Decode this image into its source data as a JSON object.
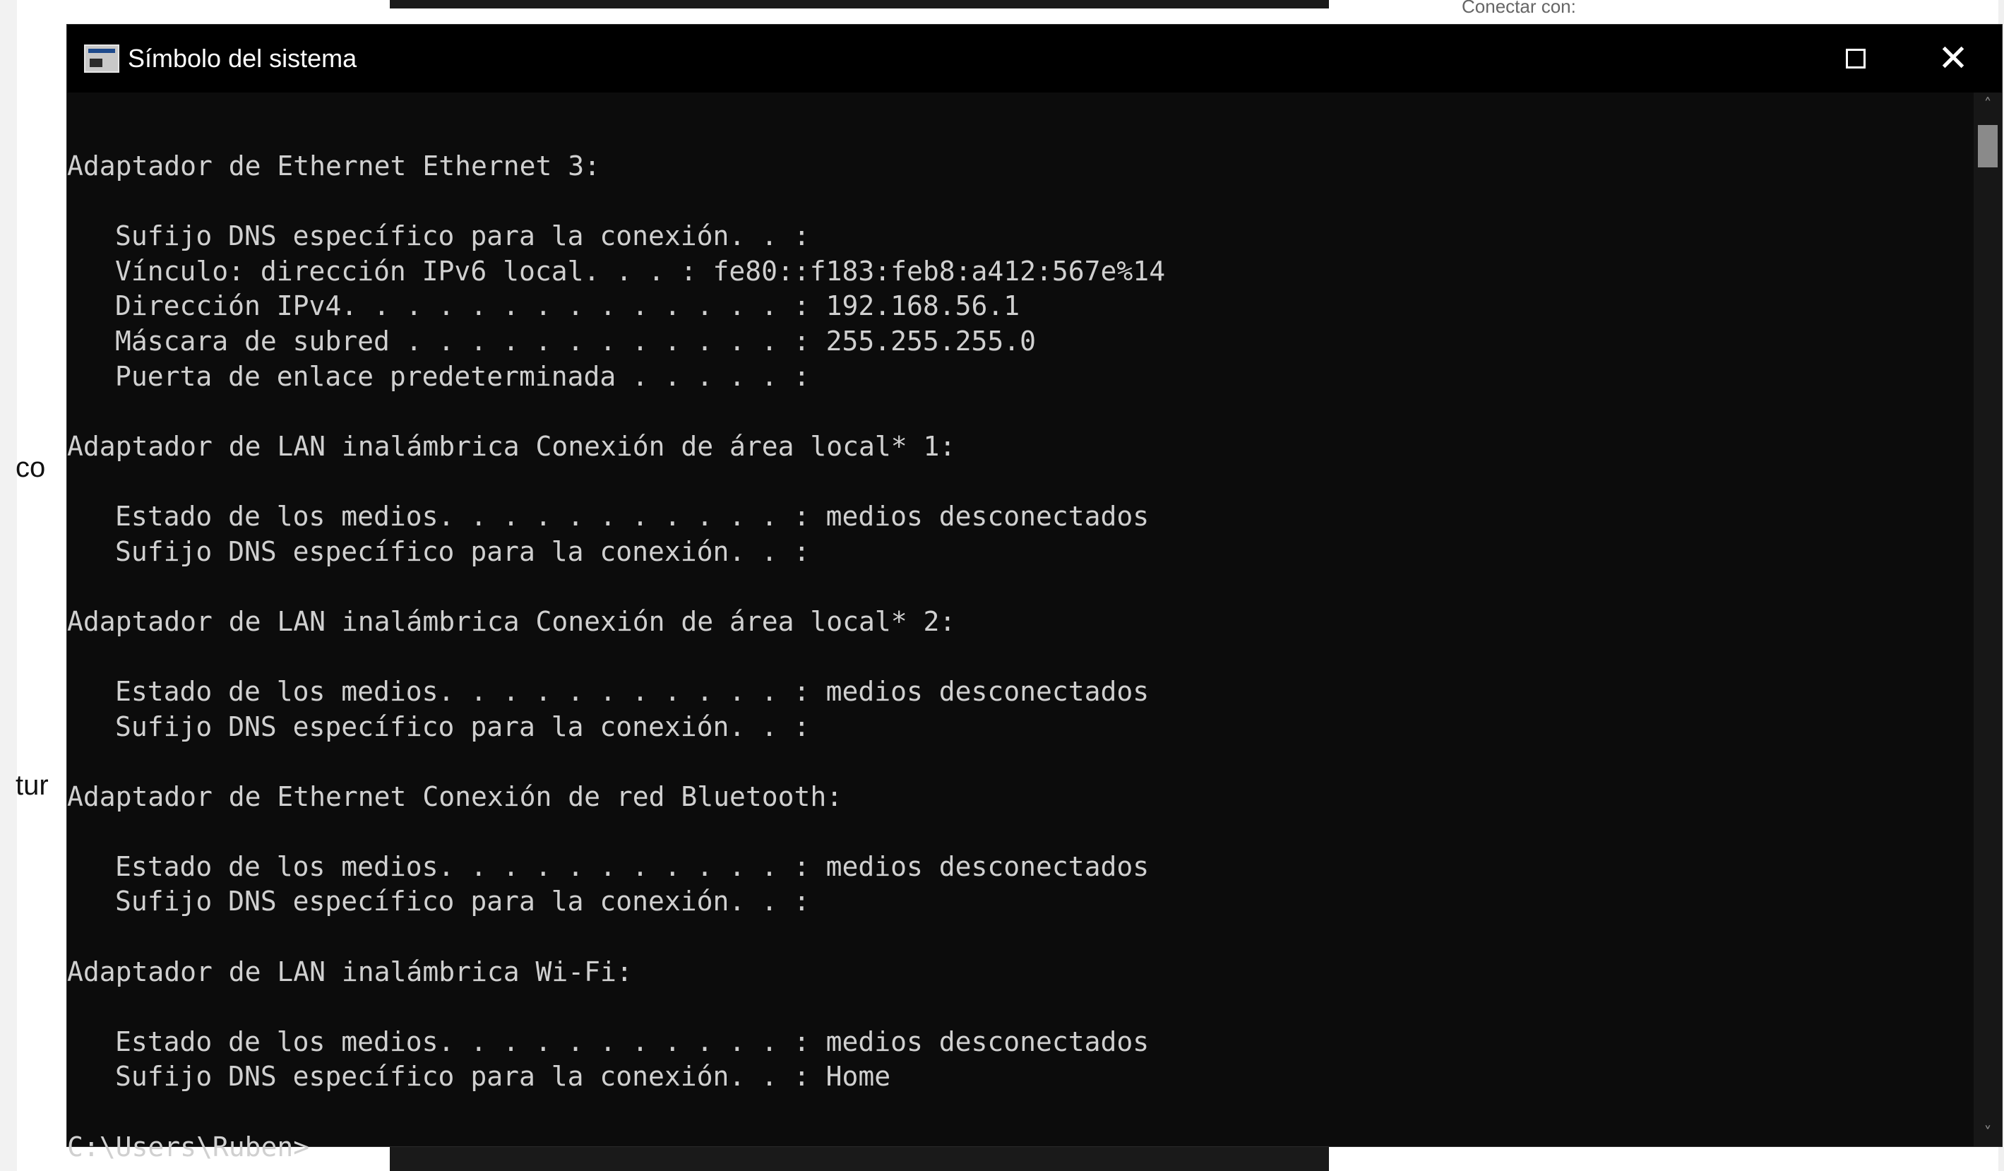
{
  "background": {
    "connect_text": "Conectar con:",
    "behind_text_1": "co",
    "behind_text_2": "tur"
  },
  "window": {
    "title": "Símbolo del sistema",
    "maximize_icon": "maximize-icon",
    "close_icon": "close-icon"
  },
  "console": {
    "lines": [
      {
        "text": "Adaptador de Ethernet Ethernet 3:",
        "indent": false
      },
      {
        "text": "",
        "indent": false
      },
      {
        "text": "Sufijo DNS específico para la conexión. . :",
        "indent": true
      },
      {
        "text": "Vínculo: dirección IPv6 local. . . : fe80::f183:feb8:a412:567e%14",
        "indent": true
      },
      {
        "text": "Dirección IPv4. . . . . . . . . . . . . . : 192.168.56.1",
        "indent": true
      },
      {
        "text": "Máscara de subred . . . . . . . . . . . . : 255.255.255.0",
        "indent": true
      },
      {
        "text": "Puerta de enlace predeterminada . . . . . :",
        "indent": true
      },
      {
        "text": "",
        "indent": false
      },
      {
        "text": "Adaptador de LAN inalámbrica Conexión de área local* 1:",
        "indent": false
      },
      {
        "text": "",
        "indent": false
      },
      {
        "text": "Estado de los medios. . . . . . . . . . . : medios desconectados",
        "indent": true
      },
      {
        "text": "Sufijo DNS específico para la conexión. . :",
        "indent": true
      },
      {
        "text": "",
        "indent": false
      },
      {
        "text": "Adaptador de LAN inalámbrica Conexión de área local* 2:",
        "indent": false
      },
      {
        "text": "",
        "indent": false
      },
      {
        "text": "Estado de los medios. . . . . . . . . . . : medios desconectados",
        "indent": true
      },
      {
        "text": "Sufijo DNS específico para la conexión. . :",
        "indent": true
      },
      {
        "text": "",
        "indent": false
      },
      {
        "text": "Adaptador de Ethernet Conexión de red Bluetooth:",
        "indent": false
      },
      {
        "text": "",
        "indent": false
      },
      {
        "text": "Estado de los medios. . . . . . . . . . . : medios desconectados",
        "indent": true
      },
      {
        "text": "Sufijo DNS específico para la conexión. . :",
        "indent": true
      },
      {
        "text": "",
        "indent": false
      },
      {
        "text": "Adaptador de LAN inalámbrica Wi-Fi:",
        "indent": false
      },
      {
        "text": "",
        "indent": false
      },
      {
        "text": "Estado de los medios. . . . . . . . . . . : medios desconectados",
        "indent": true
      },
      {
        "text": "Sufijo DNS específico para la conexión. . : Home",
        "indent": true
      },
      {
        "text": "",
        "indent": false
      },
      {
        "text": "C:\\Users\\Ruben>",
        "indent": false
      }
    ]
  },
  "colors": {
    "console_bg": "#0c0c0c",
    "console_text": "#d0d0d0",
    "titlebar_bg": "#000000"
  }
}
